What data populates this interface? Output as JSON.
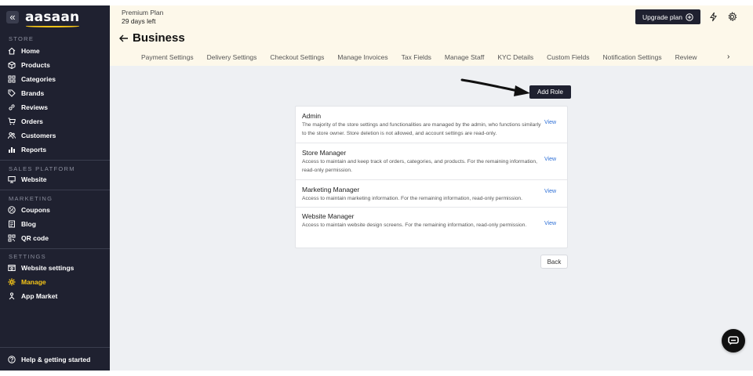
{
  "sidebar": {
    "collapse_symbol": "«",
    "logo_text": "aasaan",
    "sections": [
      {
        "title": "STORE",
        "items": [
          {
            "label": "Home",
            "icon": "home-icon"
          },
          {
            "label": "Products",
            "icon": "box-icon"
          },
          {
            "label": "Categories",
            "icon": "grid-icon"
          },
          {
            "label": "Brands",
            "icon": "tag-icon"
          },
          {
            "label": "Reviews",
            "icon": "link-icon"
          },
          {
            "label": "Orders",
            "icon": "cart-icon"
          },
          {
            "label": "Customers",
            "icon": "users-icon"
          },
          {
            "label": "Reports",
            "icon": "bar-chart-icon"
          }
        ]
      },
      {
        "title": "SALES PLATFORM",
        "items": [
          {
            "label": "Website",
            "icon": "monitor-icon"
          }
        ]
      },
      {
        "title": "MARKETING",
        "items": [
          {
            "label": "Coupons",
            "icon": "percent-icon"
          },
          {
            "label": "Blog",
            "icon": "document-icon"
          },
          {
            "label": "QR code",
            "icon": "qr-code-icon"
          }
        ]
      },
      {
        "title": "SETTINGS",
        "items": [
          {
            "label": "Website settings",
            "icon": "browser-settings-icon"
          },
          {
            "label": "Manage",
            "icon": "gear-icon",
            "active": true
          },
          {
            "label": "App Market",
            "icon": "apps-icon"
          }
        ]
      }
    ],
    "help_label": "Help & getting started",
    "active_color": "#f5c518"
  },
  "topbar": {
    "plan_name": "Premium Plan",
    "plan_days": "29 days left",
    "title": "Business",
    "upgrade_label": "Upgrade plan",
    "tabs": [
      "Payment Settings",
      "Delivery Settings",
      "Checkout Settings",
      "Manage Invoices",
      "Tax Fields",
      "Manage Staff",
      "KYC Details",
      "Custom Fields",
      "Notification Settings",
      "Review"
    ],
    "tabs_next": "›"
  },
  "main": {
    "add_role_label": "Add Role",
    "roles": [
      {
        "name": "Admin",
        "description": "The majority of the store settings and functionalities are managed by the admin, who functions similarly to the store owner. Store deletion is not allowed, and account settings are read-only.",
        "action": "View"
      },
      {
        "name": "Store Manager",
        "description": "Access to maintain and keep track of orders, categories, and products. For the remaining information, read-only permission.",
        "action": "View"
      },
      {
        "name": "Marketing Manager",
        "description": "Access to maintain marketing information. For the remaining information, read-only permission.",
        "action": "View"
      },
      {
        "name": "Website Manager",
        "description": "Access to maintain website design screens. For the remaining information, read-only permission.",
        "action": "View"
      }
    ],
    "back_label": "Back"
  },
  "colors": {
    "sidebar_bg": "#1f2130",
    "topbar_bg": "#fdf8ea",
    "content_bg": "#eef0f3",
    "link": "#2d6fd6"
  }
}
